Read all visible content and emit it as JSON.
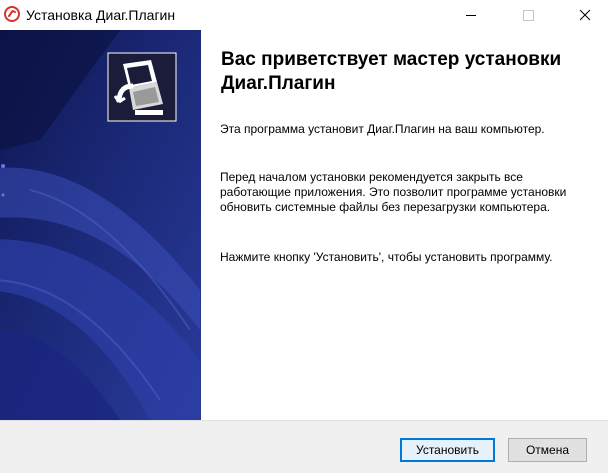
{
  "window": {
    "title": "Установка Диаг.Плагин",
    "controls": [
      "minimize-icon",
      "maximize-icon",
      "close-icon"
    ]
  },
  "banner": {
    "icon": "installer-computer-icon"
  },
  "content": {
    "heading": "Вас приветствует мастер установки Диаг.Плагин",
    "paragraph1": "Эта программа установит Диаг.Плагин на ваш компьютер.",
    "paragraph2": "Перед началом установки рекомендуется закрыть все работающие приложения. Это позволит программе установки обновить системные файлы без перезагрузки компьютера.",
    "paragraph3": "Нажмите кнопку 'Установить', чтобы установить программу."
  },
  "buttons": {
    "install": "Установить",
    "cancel": "Отмена"
  },
  "colors": {
    "banner_dark": "#0e1650",
    "banner_mid": "#1c2a7a",
    "banner_light": "#3b4fb8",
    "accent": "#0078d7",
    "app_icon": "#d9302c"
  }
}
